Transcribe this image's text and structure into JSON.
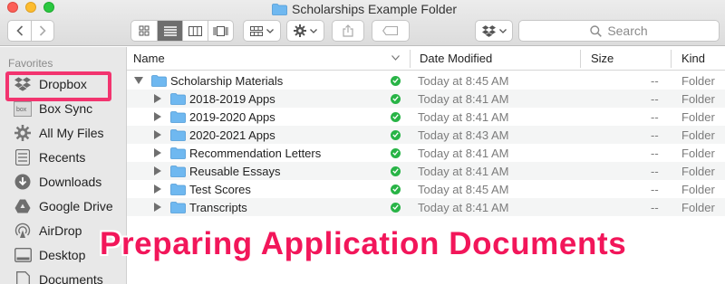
{
  "window": {
    "title": "Scholarships Example Folder"
  },
  "search": {
    "placeholder": "Search"
  },
  "sidebar": {
    "heading": "Favorites",
    "items": [
      {
        "label": "Dropbox",
        "icon": "dropbox-icon",
        "highlighted": true
      },
      {
        "label": "Box Sync",
        "icon": "box-sync-icon"
      },
      {
        "label": "All My Files",
        "icon": "all-my-files-icon"
      },
      {
        "label": "Recents",
        "icon": "recents-icon"
      },
      {
        "label": "Downloads",
        "icon": "downloads-icon"
      },
      {
        "label": "Google Drive",
        "icon": "google-drive-icon"
      },
      {
        "label": "AirDrop",
        "icon": "airdrop-icon"
      },
      {
        "label": "Desktop",
        "icon": "desktop-icon"
      },
      {
        "label": "Documents",
        "icon": "documents-icon"
      }
    ]
  },
  "columns": {
    "name": "Name",
    "date": "Date Modified",
    "size": "Size",
    "kind": "Kind"
  },
  "rows": [
    {
      "name": "Scholarship Materials",
      "date": "Today at 8:45 AM",
      "size": "--",
      "kind": "Folder",
      "expanded": true
    },
    {
      "name": "2018-2019 Apps",
      "date": "Today at 8:41 AM",
      "size": "--",
      "kind": "Folder"
    },
    {
      "name": "2019-2020 Apps",
      "date": "Today at 8:41 AM",
      "size": "--",
      "kind": "Folder"
    },
    {
      "name": "2020-2021 Apps",
      "date": "Today at 8:43 AM",
      "size": "--",
      "kind": "Folder"
    },
    {
      "name": "Recommendation Letters",
      "date": "Today at 8:41 AM",
      "size": "--",
      "kind": "Folder"
    },
    {
      "name": "Reusable Essays",
      "date": "Today at 8:41 AM",
      "size": "--",
      "kind": "Folder"
    },
    {
      "name": "Test Scores",
      "date": "Today at 8:45 AM",
      "size": "--",
      "kind": "Folder"
    },
    {
      "name": "Transcripts",
      "date": "Today at 8:41 AM",
      "size": "--",
      "kind": "Folder"
    }
  ],
  "overlay": {
    "caption": "Preparing Application Documents"
  },
  "colors": {
    "highlight": "#f2346f",
    "caption": "#f2165a",
    "sync_ok": "#28b446",
    "folder": "#6fb8f0"
  }
}
